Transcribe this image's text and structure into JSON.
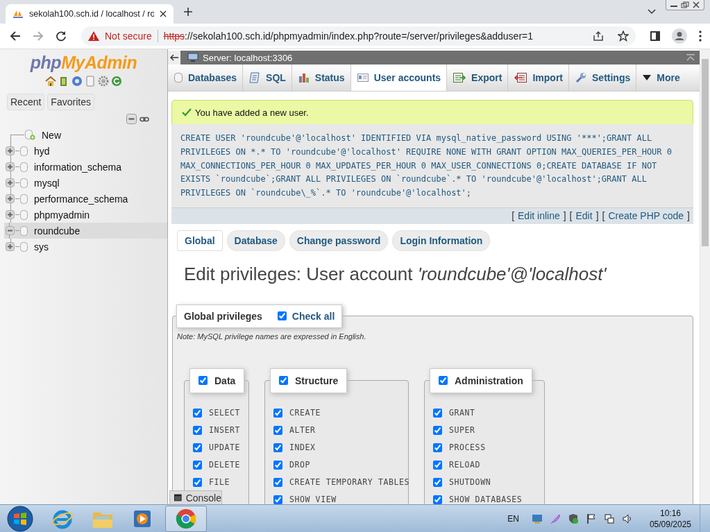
{
  "browser": {
    "tab_title": "sekolah100.sch.id / localhost / ro",
    "security": "Not secure",
    "url_scheme": "https",
    "url_rest": "://sekolah100.sch.id/phpmyadmin/index.php?route=/server/privileges&adduser=1"
  },
  "sidebar": {
    "logo_parts": [
      "php",
      "MyAdmin"
    ],
    "tabs": [
      "Recent",
      "Favorites"
    ],
    "tree": [
      {
        "label": "New",
        "kind": "new"
      },
      {
        "label": "hyd",
        "kind": "db",
        "expanded": false,
        "selected": false
      },
      {
        "label": "information_schema",
        "kind": "db",
        "expanded": false,
        "selected": false
      },
      {
        "label": "mysql",
        "kind": "db",
        "expanded": false,
        "selected": false
      },
      {
        "label": "performance_schema",
        "kind": "db",
        "expanded": false,
        "selected": false
      },
      {
        "label": "phpmyadmin",
        "kind": "db",
        "expanded": false,
        "selected": false
      },
      {
        "label": "roundcube",
        "kind": "db",
        "expanded": true,
        "selected": true
      },
      {
        "label": "sys",
        "kind": "db",
        "expanded": false,
        "selected": false
      }
    ]
  },
  "server_bar": {
    "title": "Server: localhost:3306"
  },
  "top_tabs": [
    {
      "label": "Databases",
      "selected": false
    },
    {
      "label": "SQL",
      "selected": false
    },
    {
      "label": "Status",
      "selected": false
    },
    {
      "label": "User accounts",
      "selected": true
    },
    {
      "label": "Export",
      "selected": false
    },
    {
      "label": "Import",
      "selected": false
    },
    {
      "label": "Settings",
      "selected": false
    },
    {
      "label": "More",
      "selected": false
    }
  ],
  "message": {
    "text": "You have added a new user.",
    "sql": "CREATE USER 'roundcube'@'localhost' IDENTIFIED VIA mysql_native_password USING '***';GRANT ALL PRIVILEGES ON *.* TO 'roundcube'@'localhost' REQUIRE NONE WITH GRANT OPTION MAX_QUERIES_PER_HOUR 0 MAX_CONNECTIONS_PER_HOUR 0 MAX_UPDATES_PER_HOUR 0 MAX_USER_CONNECTIONS 0;CREATE DATABASE IF NOT EXISTS `roundcube`;GRANT ALL PRIVILEGES ON `roundcube`.* TO 'roundcube'@'localhost';GRANT ALL PRIVILEGES ON `roundcube\\_%`.* TO 'roundcube'@'localhost';",
    "links": [
      {
        "before": "[",
        "label": "Edit inline",
        "after": "]"
      },
      {
        "before": "[",
        "label": "Edit",
        "after": "]"
      },
      {
        "before": "[",
        "label": "Create PHP code",
        "after": "]"
      }
    ]
  },
  "sub_tabs": [
    {
      "label": "Global",
      "selected": true
    },
    {
      "label": "Database",
      "selected": false
    },
    {
      "label": "Change password",
      "selected": false
    },
    {
      "label": "Login Information",
      "selected": false
    }
  ],
  "heading": "Edit privileges: User account *'roundcube'@'localhost'*",
  "global_privileges": {
    "legend": "Global privileges",
    "check_all": {
      "label": "Check all",
      "checked": true
    },
    "note": "Note: MySQL privilege names are expressed in English.",
    "groups": [
      {
        "title": "Data",
        "checked": true,
        "items": [
          {
            "label": "SELECT",
            "checked": true
          },
          {
            "label": "INSERT",
            "checked": true
          },
          {
            "label": "UPDATE",
            "checked": true
          },
          {
            "label": "DELETE",
            "checked": true
          },
          {
            "label": "FILE",
            "checked": true
          }
        ]
      },
      {
        "title": "Structure",
        "checked": true,
        "items": [
          {
            "label": "CREATE",
            "checked": true
          },
          {
            "label": "ALTER",
            "checked": true
          },
          {
            "label": "INDEX",
            "checked": true
          },
          {
            "label": "DROP",
            "checked": true
          },
          {
            "label": "CREATE TEMPORARY TABLES",
            "checked": true
          },
          {
            "label": "SHOW VIEW",
            "checked": true
          }
        ]
      },
      {
        "title": "Administration",
        "checked": true,
        "items": [
          {
            "label": "GRANT",
            "checked": true
          },
          {
            "label": "SUPER",
            "checked": true
          },
          {
            "label": "PROCESS",
            "checked": true
          },
          {
            "label": "RELOAD",
            "checked": true
          },
          {
            "label": "SHUTDOWN",
            "checked": true
          },
          {
            "label": "SHOW DATABASES",
            "checked": true
          }
        ]
      }
    ]
  },
  "console": {
    "label": "Console"
  },
  "taskbar": {
    "language": "EN",
    "time": "10:16",
    "date": "05/09/2025"
  }
}
